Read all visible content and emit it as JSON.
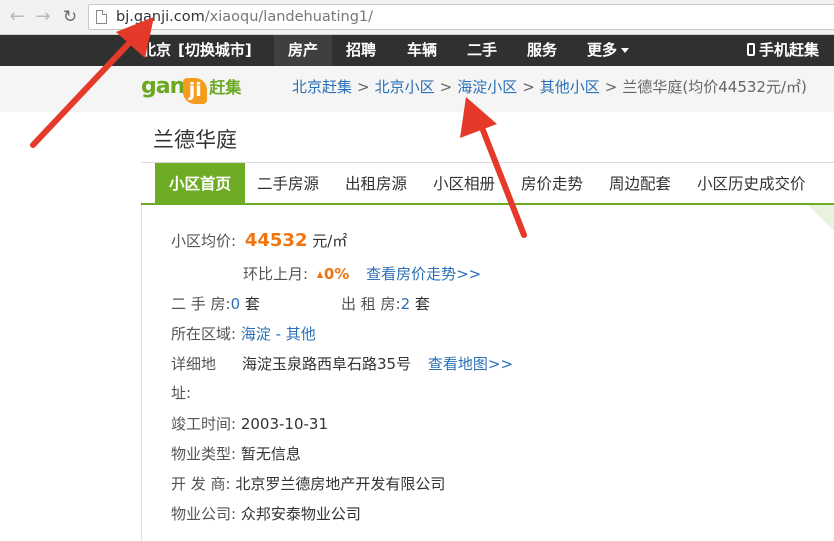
{
  "browser": {
    "url_host": "bj.ganji.com",
    "url_path": "/xiaoqu/landehuating1/"
  },
  "topnav": {
    "city": "北京",
    "switch_city": "[切换城市]",
    "items": [
      "房产",
      "招聘",
      "车辆",
      "二手",
      "服务"
    ],
    "more": "更多",
    "mobile": "手机赶集"
  },
  "logo": {
    "latin": "gan",
    "mark": "ji",
    "cn": "赶集"
  },
  "breadcrumb": {
    "items": [
      "北京赶集",
      "北京小区",
      "海淀小区",
      "其他小区"
    ],
    "current": "兰德华庭(均价44532元/㎡)",
    "separator": ">"
  },
  "page": {
    "title": "兰德华庭"
  },
  "tabs": [
    "小区首页",
    "二手房源",
    "出租房源",
    "小区相册",
    "房价走势",
    "周边配套",
    "小区历史成交价"
  ],
  "info": {
    "avg_price_label": "小区均价:",
    "avg_price": "44532",
    "avg_price_unit": "元/㎡",
    "mom_label": "环比上月:",
    "mom_value": "0%",
    "trend_link": "查看房价走势>>",
    "second_hand_label": "二 手 房:",
    "second_hand_count": "0",
    "second_hand_unit": "套",
    "rent_label": "出 租 房:",
    "rent_count": "2",
    "rent_unit": "套",
    "district_label": "所在区域:",
    "district_value": "海淀 - 其他",
    "address_label_1": "详细地",
    "address_label_2": "址:",
    "address_value": "海淀玉泉路西阜石路35号",
    "map_link": "查看地图>>",
    "completed_label": "竣工时间:",
    "completed_value": "2003-10-31",
    "type_label": "物业类型:",
    "type_value": "暂无信息",
    "developer_label": "开 发 商:",
    "developer_value": "北京罗兰德房地产开发有限公司",
    "mgmt_label": "物业公司:",
    "mgmt_value": "众邦安泰物业公司"
  },
  "colors": {
    "brand_green": "#6fac25",
    "price_orange": "#f07410",
    "link_blue": "#2a6fb7",
    "annotation_red": "#e53a2a"
  }
}
